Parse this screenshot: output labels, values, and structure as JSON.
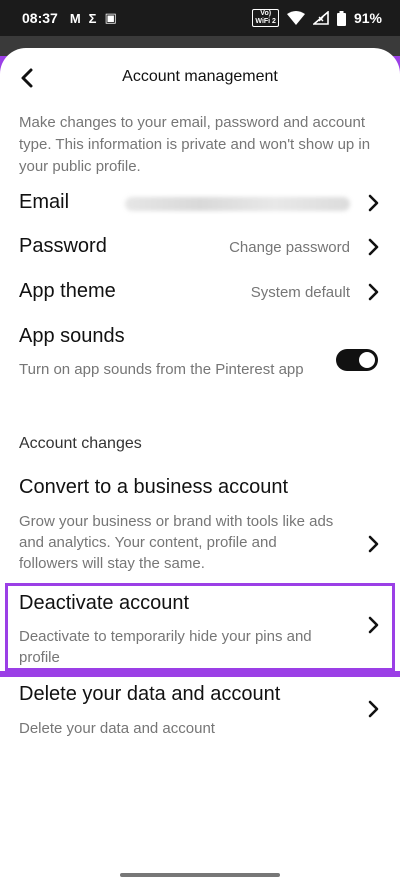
{
  "status_bar": {
    "time": "08:37",
    "notifications": [
      "M",
      "Σ",
      "▣"
    ],
    "volte_top": "Vo)",
    "volte_bottom": "WiFi 2",
    "battery": "91%"
  },
  "header": {
    "title": "Account management"
  },
  "intro": "Make changes to your email, password and account type. This information is private and won't show up in your public profile.",
  "rows": {
    "email": {
      "label": "Email"
    },
    "password": {
      "label": "Password",
      "value": "Change password"
    },
    "app_theme": {
      "label": "App theme",
      "value": "System default"
    },
    "app_sounds": {
      "label": "App sounds",
      "description": "Turn on app sounds from the Pinterest app",
      "enabled": true
    }
  },
  "account_changes": {
    "section_label": "Account changes",
    "business": {
      "label": "Convert to a business account",
      "description": "Grow your business or brand with tools like ads and analytics. Your content, profile and followers will stay the same."
    },
    "deactivate": {
      "label": "Deactivate account",
      "description": "Deactivate to temporarily hide your pins and profile"
    },
    "delete": {
      "label": "Delete your data and account",
      "description": "Delete your data and account"
    }
  },
  "colors": {
    "highlight": "#9b3fe6",
    "toggle_on": "#111111"
  },
  "icons": [
    "back-arrow-icon",
    "chevron-right-icon",
    "wifi-icon",
    "signal-icon",
    "battery-icon"
  ]
}
